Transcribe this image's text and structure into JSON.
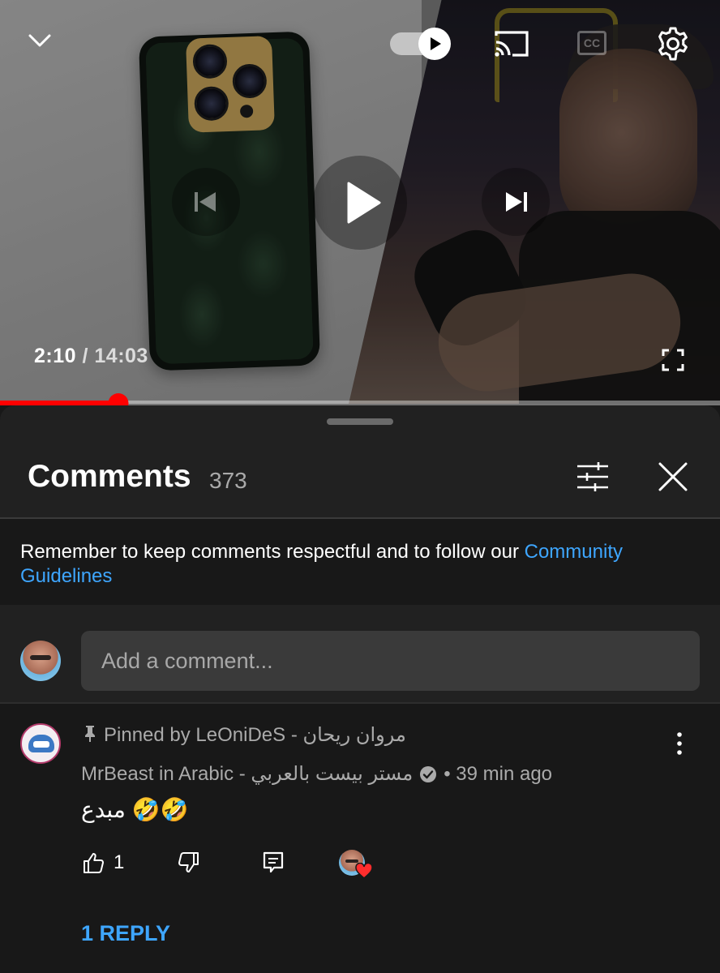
{
  "player": {
    "current_time": "2:10",
    "separator": " / ",
    "duration": "14:03",
    "progress": 0.1645,
    "autoplay_on": true,
    "icons": [
      "chevron-down-icon",
      "autoplay-toggle",
      "cast-icon",
      "captions-icon",
      "settings-icon",
      "previous-icon",
      "play-icon",
      "next-icon",
      "fullscreen-icon"
    ],
    "captions_label": "CC"
  },
  "comments": {
    "title": "Comments",
    "count": "373",
    "notice_text": "Remember to keep comments respectful and to follow our ",
    "notice_link": "Community Guidelines",
    "input_placeholder": "Add a comment...",
    "items": [
      {
        "pinned_by": "Pinned by LeOniDeS - مروان ريحان",
        "author": "MrBeast in Arabic - مستر بيست بالعربي",
        "verified": true,
        "time": "• 39 min ago",
        "text": "مبدع 🤣🤣",
        "likes": "1",
        "creator_heart": true,
        "replies_label": "1 REPLY"
      }
    ]
  },
  "colors": {
    "accent_red": "#ff0000",
    "link_blue": "#3ea6ff",
    "panel_bg": "#212121",
    "page_bg": "#181818"
  }
}
